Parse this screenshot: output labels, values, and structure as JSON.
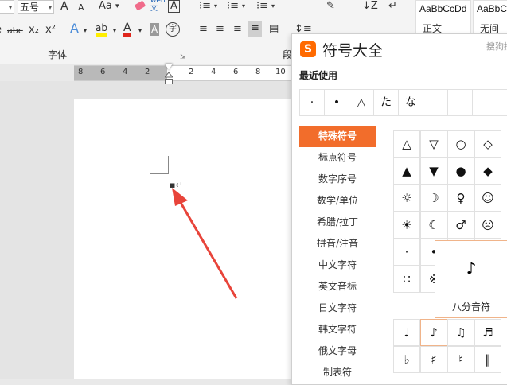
{
  "ribbon": {
    "font_name": "",
    "font_size": "五号",
    "grow_font": "A",
    "shrink_font": "A",
    "change_case": "Aa",
    "clear_format": "",
    "phonetic": "wén\n文",
    "char_border": "A",
    "strike": "abc",
    "subscript": "x₂",
    "superscript": "x²",
    "text_effect": "A",
    "highlight": "ab",
    "font_color": "A",
    "char_shading": "A",
    "enclose_char": "字",
    "font_group_label": "字体",
    "paragraph_group_label": "段",
    "style1_sample": "AaBbCcDd",
    "style1_name": "正文",
    "style2_sample": "AaBbC",
    "style2_name": "无间"
  },
  "ruler": {
    "ticks": [
      "8",
      "6",
      "4",
      "2",
      "2",
      "4",
      "6",
      "8",
      "10"
    ]
  },
  "symbol_dialog": {
    "title": "符号大全",
    "subtitle": "搜狗拼",
    "recent_label": "最近使用",
    "recent_symbols": [
      "·",
      "•",
      "△",
      "た",
      "な",
      "",
      "",
      "",
      ""
    ],
    "categories": [
      "特殊符号",
      "标点符号",
      "数字序号",
      "数学/单位",
      "希腊/拉丁",
      "拼音/注音",
      "中文字符",
      "英文音标",
      "日文字符",
      "韩文字符",
      "俄文字母",
      "制表符"
    ],
    "active_category": "特殊符号",
    "symbols_grid": [
      [
        "△",
        "▽",
        "○",
        "◇"
      ],
      [
        "▲",
        "▼",
        "●",
        "◆"
      ],
      [
        "☼",
        "☽",
        "♀",
        "☺"
      ],
      [
        "☀",
        "☾",
        "♂",
        "☹"
      ],
      [
        "·",
        "•",
        "",
        ""
      ],
      [
        "∷",
        "※",
        "",
        ""
      ]
    ],
    "music_grid": [
      [
        "♩",
        "♪",
        "♫",
        "♬"
      ],
      [
        "♭",
        "♯",
        "♮",
        "‖"
      ]
    ],
    "preview_symbol": "♪",
    "preview_name": "八分音符",
    "accent_color": "#f26d2b"
  }
}
